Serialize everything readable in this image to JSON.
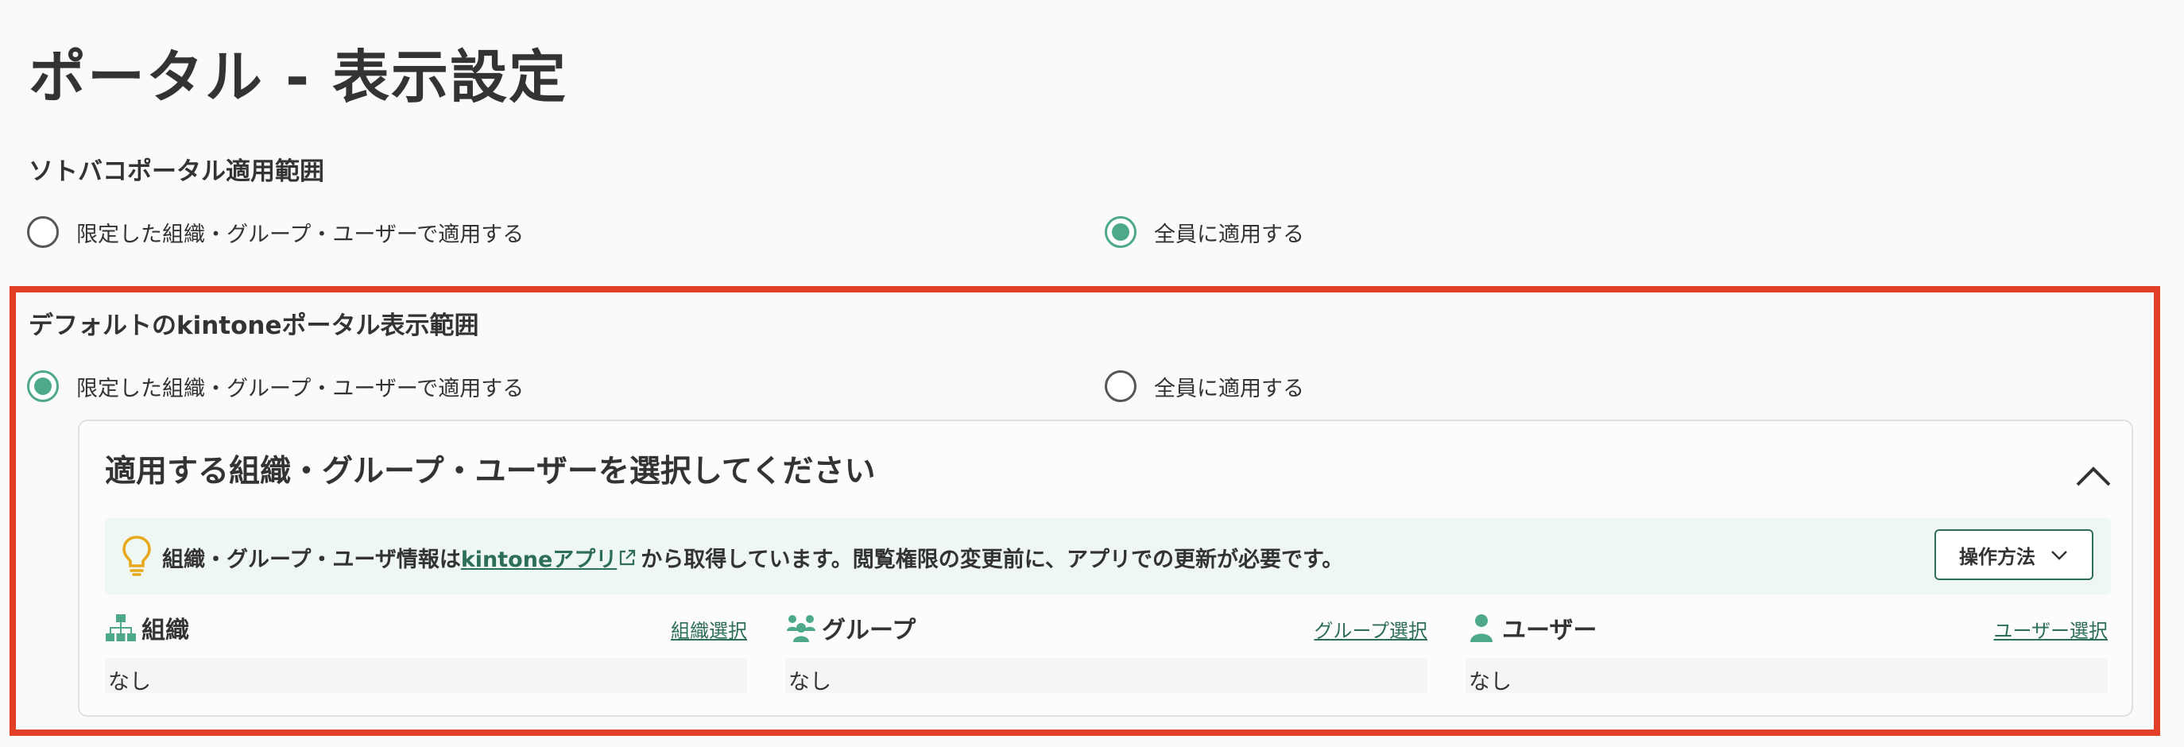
{
  "page": {
    "title": "ポータル - 表示設定"
  },
  "sotobako_section": {
    "heading": "ソトバコポータル適用範囲",
    "options": [
      {
        "label": "限定した組織・グループ・ユーザーで適用する",
        "checked": false
      },
      {
        "label": "全員に適用する",
        "checked": true
      }
    ]
  },
  "kintone_section": {
    "heading": "デフォルトのkintoneポータル表示範囲",
    "options": [
      {
        "label": "限定した組織・グループ・ユーザーで適用する",
        "checked": true
      },
      {
        "label": "全員に適用する",
        "checked": false
      }
    ]
  },
  "select_card": {
    "title": "適用する組織・グループ・ユーザーを選択してください",
    "collapse_icon": "chevron-up-icon",
    "info": {
      "icon": "lightbulb-icon",
      "text_before": "組織・グループ・ユーザ情報は",
      "link_text": "kintoneアプリ",
      "link_icon": "external-link-icon",
      "text_after": "から取得しています。閲覧権限の変更前に、アプリでの更新が必要です。",
      "howto_label": "操作方法"
    },
    "columns": [
      {
        "icon": "org-tree-icon",
        "label": "組織",
        "link": "組織選択",
        "value": "なし"
      },
      {
        "icon": "group-icon",
        "label": "グループ",
        "link": "グループ選択",
        "value": "なし"
      },
      {
        "icon": "user-icon",
        "label": "ユーザー",
        "link": "ユーザー選択",
        "value": "なし"
      }
    ]
  },
  "colors": {
    "accent": "#4ea88c",
    "link": "#2d6e58",
    "highlight": "#e23f26",
    "info_bg": "#eff7f3"
  }
}
